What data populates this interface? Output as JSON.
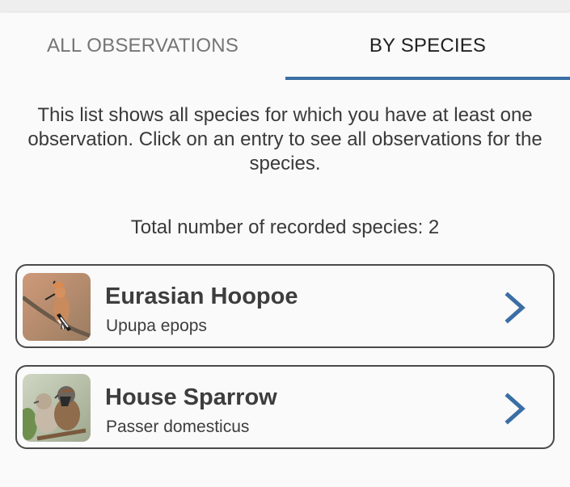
{
  "tabs": [
    {
      "label": "ALL OBSERVATIONS",
      "selected": false
    },
    {
      "label": "BY SPECIES",
      "selected": true
    }
  ],
  "colors": {
    "accent": "#3a6ea5",
    "text": "#3d3d3d"
  },
  "intro_text": "This list shows all species for which you have at least one observation. Click on an entry to see all observations for the species.",
  "total_text": "Total number of recorded species: 2",
  "species": [
    {
      "name": "Eurasian Hoopoe",
      "latin": "Upupa epops",
      "icon": "chevron-right-icon"
    },
    {
      "name": "House Sparrow",
      "latin": "Passer domesticus",
      "icon": "chevron-right-icon"
    }
  ]
}
